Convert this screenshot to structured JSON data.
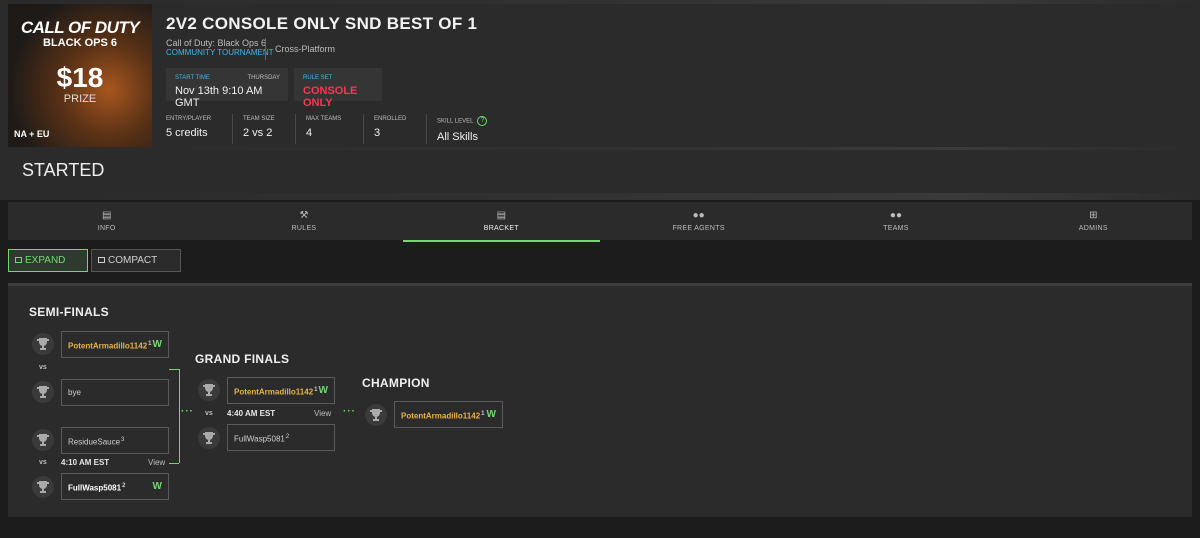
{
  "cover": {
    "logo_line1": "CALL OF DUTY",
    "logo_line2": "BLACK OPS 6",
    "price": "$18",
    "prize_label": "PRIZE",
    "region": "NA + EU"
  },
  "header": {
    "title": "2V2 CONSOLE ONLY SND BEST OF 1",
    "game": "Call of Duty: Black Ops 6",
    "tournament_type": "COMMUNITY TOURNAMENT",
    "platform": "Cross-Platform",
    "start_label": "START TIME",
    "start_day": "THURSDAY",
    "start_value": "Nov 13th 9:10 AM GMT",
    "rule_label": "RULE SET",
    "rule_value": "CONSOLE ONLY",
    "stats": [
      {
        "label": "ENTRY/PLAYER",
        "value": "5 credits"
      },
      {
        "label": "TEAM SIZE",
        "value": "2 vs 2"
      },
      {
        "label": "MAX TEAMS",
        "value": "4"
      },
      {
        "label": "ENROLLED",
        "value": "3"
      },
      {
        "label": "SKILL LEVEL",
        "value": "All Skills"
      }
    ]
  },
  "status": "STARTED",
  "tabs": [
    {
      "label": "INFO",
      "icon": "info-icon"
    },
    {
      "label": "RULES",
      "icon": "gavel-icon"
    },
    {
      "label": "BRACKET",
      "icon": "bracket-icon"
    },
    {
      "label": "FREE AGENTS",
      "icon": "free-agents-icon"
    },
    {
      "label": "TEAMS",
      "icon": "teams-icon"
    },
    {
      "label": "ADMINS",
      "icon": "admins-icon"
    }
  ],
  "view_buttons": {
    "expand": "EXPAND",
    "compact": "COMPACT"
  },
  "bracket": {
    "semi_title": "SEMI-FINALS",
    "grand_title": "GRAND FINALS",
    "champion_title": "CHAMPION",
    "vs": "vs",
    "view": "View",
    "semi1": {
      "team1": {
        "name": "PotentArmadillo1142",
        "seed": "1",
        "result": "W"
      },
      "team2": {
        "name": "bye"
      }
    },
    "semi2": {
      "team1": {
        "name": "ResidueSauce",
        "seed": "3"
      },
      "time": "4:10 AM EST",
      "team2": {
        "name": "FullWasp5081",
        "seed": "2",
        "result": "W"
      }
    },
    "grand": {
      "team1": {
        "name": "PotentArmadillo1142",
        "seed": "1",
        "result": "W"
      },
      "time": "4:40 AM EST",
      "team2": {
        "name": "FullWasp5081",
        "seed": "2"
      }
    },
    "champion": {
      "name": "PotentArmadillo1142",
      "seed": "1",
      "result": "W"
    }
  },
  "colors": {
    "accent": "#6fd96f",
    "rule_red": "#ff3352",
    "link_blue": "#3fb8e8",
    "winner_gold": "#e7b34a"
  }
}
